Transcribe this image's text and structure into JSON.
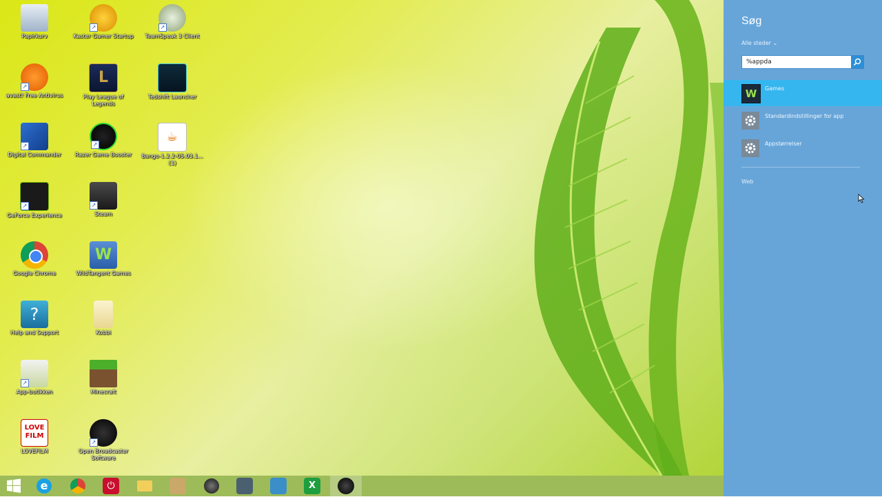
{
  "desktop": {
    "icons": [
      {
        "label": "Papirkurv"
      },
      {
        "label": "Kaster Gamer Startup"
      },
      {
        "label": "TeamSpeak 3 Client"
      },
      {
        "label": "avast! Free Antivirus"
      },
      {
        "label": "Play League of Legends"
      },
      {
        "label": "Tedshift Launcher"
      },
      {
        "label": "Digital Commander"
      },
      {
        "label": "Razer Game Booster"
      },
      {
        "label": "Bango-1.2.2-05.03.1... (1)"
      },
      {
        "label": "GeForce Experience"
      },
      {
        "label": "Steam"
      },
      {
        "label": "Google Chrome"
      },
      {
        "label": "WildTangent Games"
      },
      {
        "label": "Help and Support"
      },
      {
        "label": "Kobbi"
      },
      {
        "label": "App-butikken"
      },
      {
        "label": "Minecraft"
      },
      {
        "label": "LOVEFILM"
      },
      {
        "label": "Open Broadcaster Software"
      }
    ]
  },
  "taskbar": {
    "items": [
      {
        "name": "start-button"
      },
      {
        "name": "internet-explorer"
      },
      {
        "name": "google-chrome"
      },
      {
        "name": "power-app"
      },
      {
        "name": "file-explorer"
      },
      {
        "name": "app-5"
      },
      {
        "name": "app-6"
      },
      {
        "name": "app-7"
      },
      {
        "name": "app-8"
      },
      {
        "name": "excel"
      },
      {
        "name": "obs"
      }
    ]
  },
  "charm": {
    "title": "Søg",
    "scope": "Alle steder  ⌄",
    "search_value": "%appda",
    "results": [
      {
        "label": "Games"
      },
      {
        "label": "Standardindstillinger for app"
      },
      {
        "label": "Appstørrelser"
      }
    ],
    "web_link": "Web"
  },
  "colors": {
    "charm_bg": "#67a5d9",
    "selected": "#36b6ef",
    "search_button": "#2d8fd6"
  }
}
